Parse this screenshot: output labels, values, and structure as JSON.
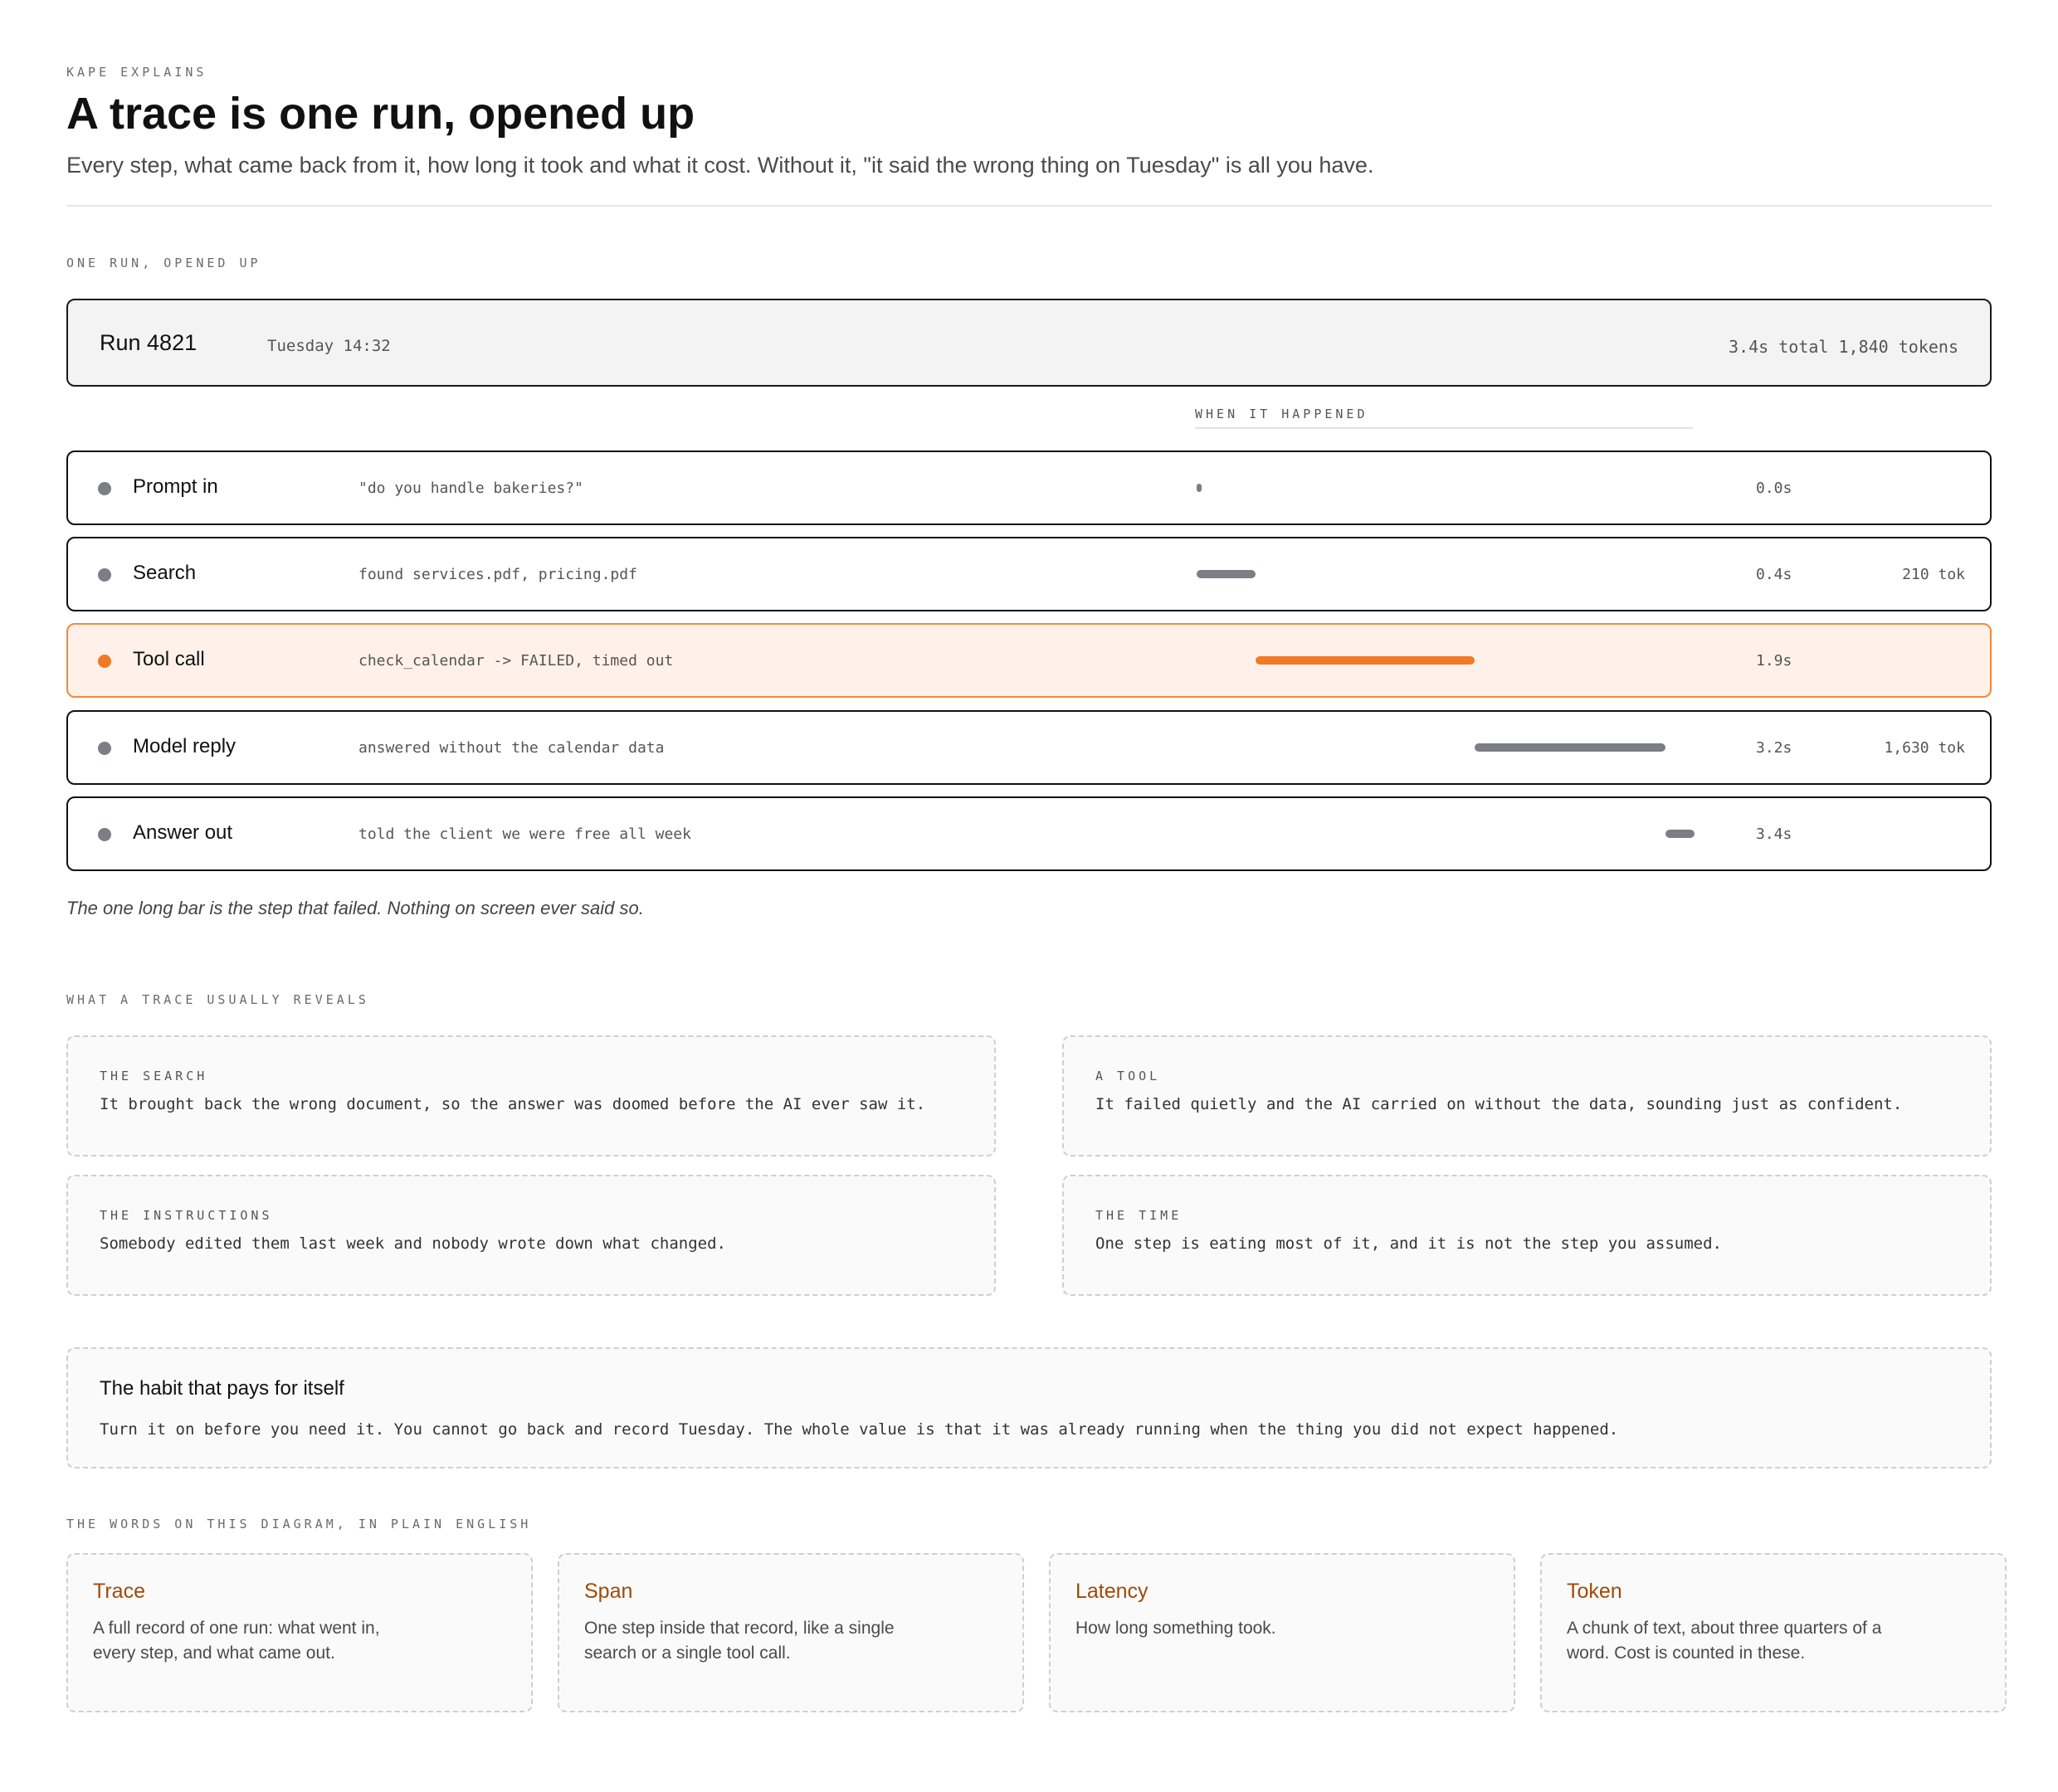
{
  "header": {
    "kicker": "KAPE EXPLAINS",
    "title": "A trace is one run, opened up",
    "subtitle": "Every step, what came back from it, how long it took and what it cost. Without it, \"it said the wrong thing on Tuesday\" is all you have."
  },
  "sections": {
    "run": "ONE RUN, OPENED UP",
    "reveals": "WHAT A TRACE USUALLY REVEALS",
    "glossary": "THE WORDS ON THIS DIAGRAM, IN PLAIN ENGLISH"
  },
  "run": {
    "name": "Run 4821",
    "time": "Tuesday 14:32",
    "totals": "3.4s total 1,840 tokens",
    "timeline_label": "WHEN IT HAPPENED",
    "total_seconds": 3.4
  },
  "steps": [
    {
      "name": "Prompt in",
      "detail": "\"do you handle bakeries?\"",
      "time": "0.0s",
      "tokens": "",
      "start": 0.0,
      "end": 0.0,
      "failed": false
    },
    {
      "name": "Search",
      "detail": "found services.pdf, pricing.pdf",
      "time": "0.4s",
      "tokens": "210 tok",
      "start": 0.0,
      "end": 0.4,
      "failed": false
    },
    {
      "name": "Tool call",
      "detail": "check_calendar -> FAILED, timed out",
      "time": "1.9s",
      "tokens": "",
      "start": 0.4,
      "end": 1.9,
      "failed": true
    },
    {
      "name": "Model reply",
      "detail": "answered without the calendar data",
      "time": "3.2s",
      "tokens": "1,630 tok",
      "start": 1.9,
      "end": 3.2,
      "failed": false
    },
    {
      "name": "Answer out",
      "detail": "told the client we were free all week",
      "time": "3.4s",
      "tokens": "",
      "start": 3.2,
      "end": 3.4,
      "failed": false
    }
  ],
  "caption": "The one long bar is the step that failed. Nothing on screen ever said so.",
  "reveals": [
    {
      "label": "THE SEARCH",
      "text": "It brought back the wrong document, so the answer was doomed before the AI ever saw it."
    },
    {
      "label": "A TOOL",
      "text": "It failed quietly and the AI carried on without the data, sounding just as confident."
    },
    {
      "label": "THE INSTRUCTIONS",
      "text": "Somebody edited them last week and nobody wrote down what changed."
    },
    {
      "label": "THE TIME",
      "text": "One step is eating most of it, and it is not the step you assumed."
    }
  ],
  "habit": {
    "title": "The habit that pays for itself",
    "text": "Turn it on before you need it. You cannot go back and record Tuesday. The whole value is that it was already running when the thing you did not expect happened."
  },
  "glossary": [
    {
      "term": "Trace",
      "definition": "A full record of one run: what went in, every step, and what came out."
    },
    {
      "term": "Span",
      "definition": "One step inside that record, like a single search or a single tool call."
    },
    {
      "term": "Latency",
      "definition": "How long something took."
    },
    {
      "term": "Token",
      "definition": "A chunk of text, about three quarters of a word. Cost is counted in these."
    }
  ],
  "colors": {
    "accent": "#f07a25",
    "neutral_bar": "#7b7e85",
    "term": "#a04a08"
  }
}
